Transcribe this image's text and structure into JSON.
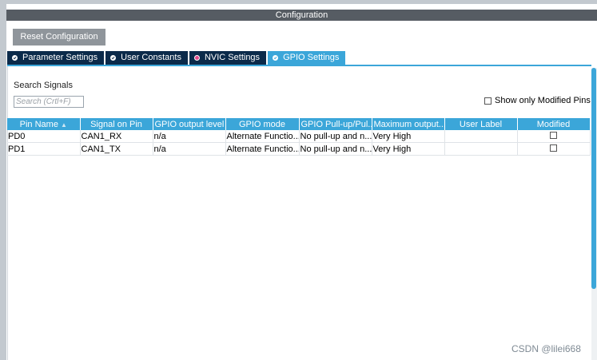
{
  "window": {
    "title": "Configuration"
  },
  "toolbar": {
    "reset_label": "Reset Configuration"
  },
  "tabs": [
    {
      "label": "Parameter Settings",
      "icon": "check-circle-icon",
      "active": false
    },
    {
      "label": "User Constants",
      "icon": "check-circle-icon",
      "active": false
    },
    {
      "label": "NVIC Settings",
      "icon": "pink-dot-icon",
      "active": false
    },
    {
      "label": "GPIO Settings",
      "icon": "check-circle-icon",
      "active": true
    }
  ],
  "search": {
    "label": "Search Signals",
    "placeholder": "Search (Crtl+F)",
    "value": ""
  },
  "filter": {
    "only_modified_label": "Show only Modified Pins",
    "checked": false
  },
  "table": {
    "columns": [
      "Pin Name",
      "Signal on Pin",
      "GPIO output level",
      "GPIO mode",
      "GPIO Pull-up/Pul...",
      "Maximum output...",
      "User Label",
      "Modified"
    ],
    "rows": [
      [
        "PD0",
        "CAN1_RX",
        "n/a",
        "Alternate Functio...",
        "No pull-up and n...",
        "Very High",
        "",
        false
      ],
      [
        "PD1",
        "CAN1_TX",
        "n/a",
        "Alternate Functio...",
        "No pull-up and n...",
        "Very High",
        "",
        false
      ]
    ]
  },
  "watermark": "CSDN @lilei668",
  "colors": {
    "accent": "#3ba6d9",
    "tab_dark": "#0b2a4a",
    "title_bar": "#565c63",
    "button": "#8f959b"
  }
}
